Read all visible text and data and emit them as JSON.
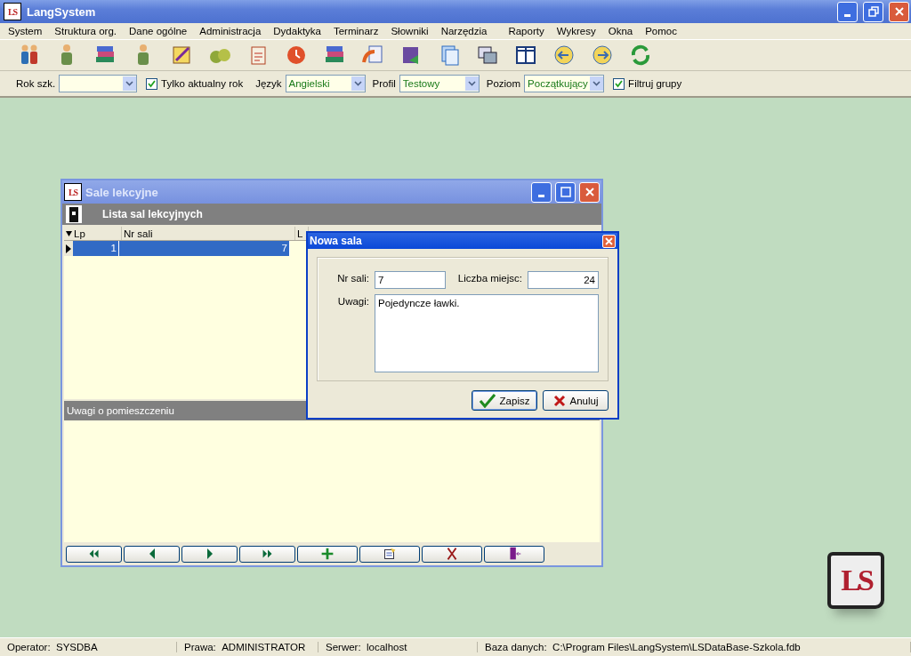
{
  "window": {
    "title": "LangSystem",
    "icon_text": "LS"
  },
  "menu": [
    "System",
    "Struktura org.",
    "Dane ogólne",
    "Administracja",
    "Dydaktyka",
    "Terminarz",
    "Słowniki",
    "Narzędzia",
    "Raporty",
    "Wykresy",
    "Okna",
    "Pomoc"
  ],
  "toolbar": [
    {
      "kind": "people"
    },
    {
      "kind": "person"
    },
    {
      "kind": "stack"
    },
    {
      "kind": "person"
    },
    {
      "kind": "notepad"
    },
    {
      "kind": "money"
    },
    {
      "kind": "clipboard"
    },
    {
      "kind": "clock"
    },
    {
      "kind": "stack"
    },
    {
      "kind": "arrow-doc"
    },
    {
      "kind": "book"
    },
    {
      "kind": "pages"
    },
    {
      "kind": "windows"
    },
    {
      "kind": "columns"
    },
    {
      "kind": "left-circle"
    },
    {
      "kind": "right-circle"
    },
    {
      "kind": "refresh"
    }
  ],
  "filters": [
    {
      "kind": "combo",
      "label": "Rok szk."
    },
    {
      "kind": "check",
      "label": "Tylko aktualny rok",
      "checked": true
    },
    {
      "kind": "combo",
      "label": "Język",
      "value": "Angielski"
    },
    {
      "kind": "combo",
      "label": "Profil",
      "value": "Testowy"
    },
    {
      "kind": "combo",
      "label": "Poziom",
      "value": "Początkujący"
    },
    {
      "kind": "check",
      "label": "Filtruj grupy",
      "checked": true
    }
  ],
  "child_window": {
    "title": "Sale lekcyjne",
    "icon_text": "LS",
    "header": "Lista sal lekcyjnych",
    "grid": {
      "columns": [
        "Lp",
        "Nr sali",
        "L"
      ],
      "rows": [
        {
          "cells": [
            "1",
            "7"
          ],
          "selected": true
        }
      ]
    },
    "notes_header": "Uwagi o pomieszczeniu",
    "nav_buttons": [
      {
        "kind": "first"
      },
      {
        "kind": "prev"
      },
      {
        "kind": "next"
      },
      {
        "kind": "last"
      },
      {
        "kind": "add"
      },
      {
        "kind": "edit"
      },
      {
        "kind": "delete"
      },
      {
        "kind": "exit"
      }
    ]
  },
  "dialog": {
    "title": "Nowa sala",
    "room_label": "Nr sali:",
    "room_value": "7",
    "seats_label": "Liczba miejsc:",
    "seats_value": "24",
    "notes_label": "Uwagi:",
    "notes_value": "Pojedyncze ławki.",
    "buttons": [
      {
        "kind": "ok",
        "label": "Zapisz"
      },
      {
        "kind": "cancel",
        "label": "Anuluj"
      }
    ]
  },
  "status_bar": [
    {
      "label": "Operator:",
      "value": "SYSDBA"
    },
    {
      "label": "Prawa:",
      "value": "ADMINISTRATOR"
    },
    {
      "label": "Serwer:",
      "value": "localhost"
    },
    {
      "label": "Baza danych:",
      "value": "C:\\Program Files\\LangSystem\\LSDataBase-Szkola.fdb"
    }
  ],
  "logo": {
    "text": "LS"
  }
}
